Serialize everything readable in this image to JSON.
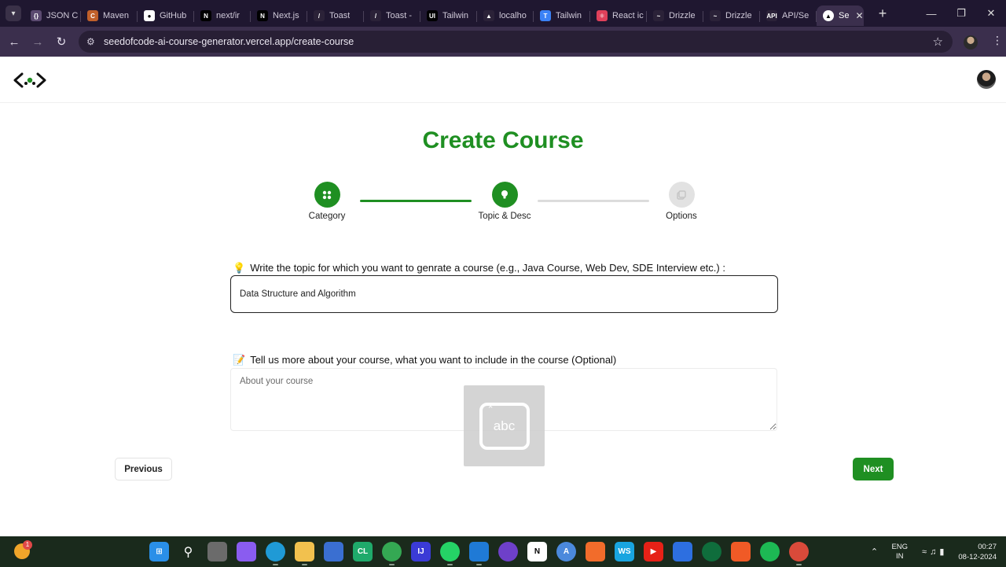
{
  "browser": {
    "tabs": [
      {
        "label": "JSON C",
        "icon": "json-icon",
        "color": "#5b4a70"
      },
      {
        "label": "Maven",
        "icon": "maven-icon",
        "color": "#c0602a"
      },
      {
        "label": "GitHub",
        "icon": "github-icon",
        "color": "#ffffff"
      },
      {
        "label": "next/ir",
        "icon": "nextjs-icon",
        "color": "#000000"
      },
      {
        "label": "Next.js",
        "icon": "nextjs-icon",
        "color": "#000000"
      },
      {
        "label": "Toast",
        "icon": "toast-icon",
        "color": "#2b2238"
      },
      {
        "label": "Toast -",
        "icon": "toast-icon",
        "color": "#2b2238"
      },
      {
        "label": "Tailwin",
        "icon": "ui-icon",
        "color": "#000000"
      },
      {
        "label": "localho",
        "icon": "localhost-icon",
        "color": "#2b2238"
      },
      {
        "label": "Tailwin",
        "icon": "tailwind-icon",
        "color": "#3b82f6"
      },
      {
        "label": "React ic",
        "icon": "react-icon",
        "color": "#e0405a"
      },
      {
        "label": "Drizzle",
        "icon": "drizzle-icon",
        "color": "#2b2238"
      },
      {
        "label": "Drizzle",
        "icon": "drizzle-icon",
        "color": "#2b2238"
      },
      {
        "label": "API/Se",
        "icon": "api-icon",
        "color": "#2b2238"
      }
    ],
    "active_tab": {
      "label": "Se",
      "icon": "vercel-icon"
    },
    "url": "seedofcode-ai-course-generator.vercel.app/create-course"
  },
  "page": {
    "title": "Create Course",
    "steps": [
      {
        "label": "Category",
        "icon": "grid-icon",
        "state": "done"
      },
      {
        "label": "Topic & Desc",
        "icon": "lightbulb-icon",
        "state": "done"
      },
      {
        "label": "Options",
        "icon": "options-icon",
        "state": "todo"
      }
    ],
    "topic": {
      "emoji": "💡",
      "label": "Write the topic for which you want to genrate a course (e.g., Java Course, Web Dev, SDE Interview etc.) :",
      "value": "Data Structure and Algorithm"
    },
    "description": {
      "emoji": "📝",
      "label": "Tell us more about your course, what you want to include in the course (Optional)",
      "placeholder": "About your course"
    },
    "ime_overlay_text": "abc",
    "buttons": {
      "previous": "Previous",
      "next": "Next"
    }
  },
  "taskbar": {
    "notification_count": "1",
    "language": {
      "line1": "ENG",
      "line2": "IN"
    },
    "time": "00:27",
    "date": "08-12-2024"
  },
  "colors": {
    "brand_green": "#1f8f22",
    "browser_frame": "#1f1730",
    "taskbar": "#1a2a1c"
  }
}
